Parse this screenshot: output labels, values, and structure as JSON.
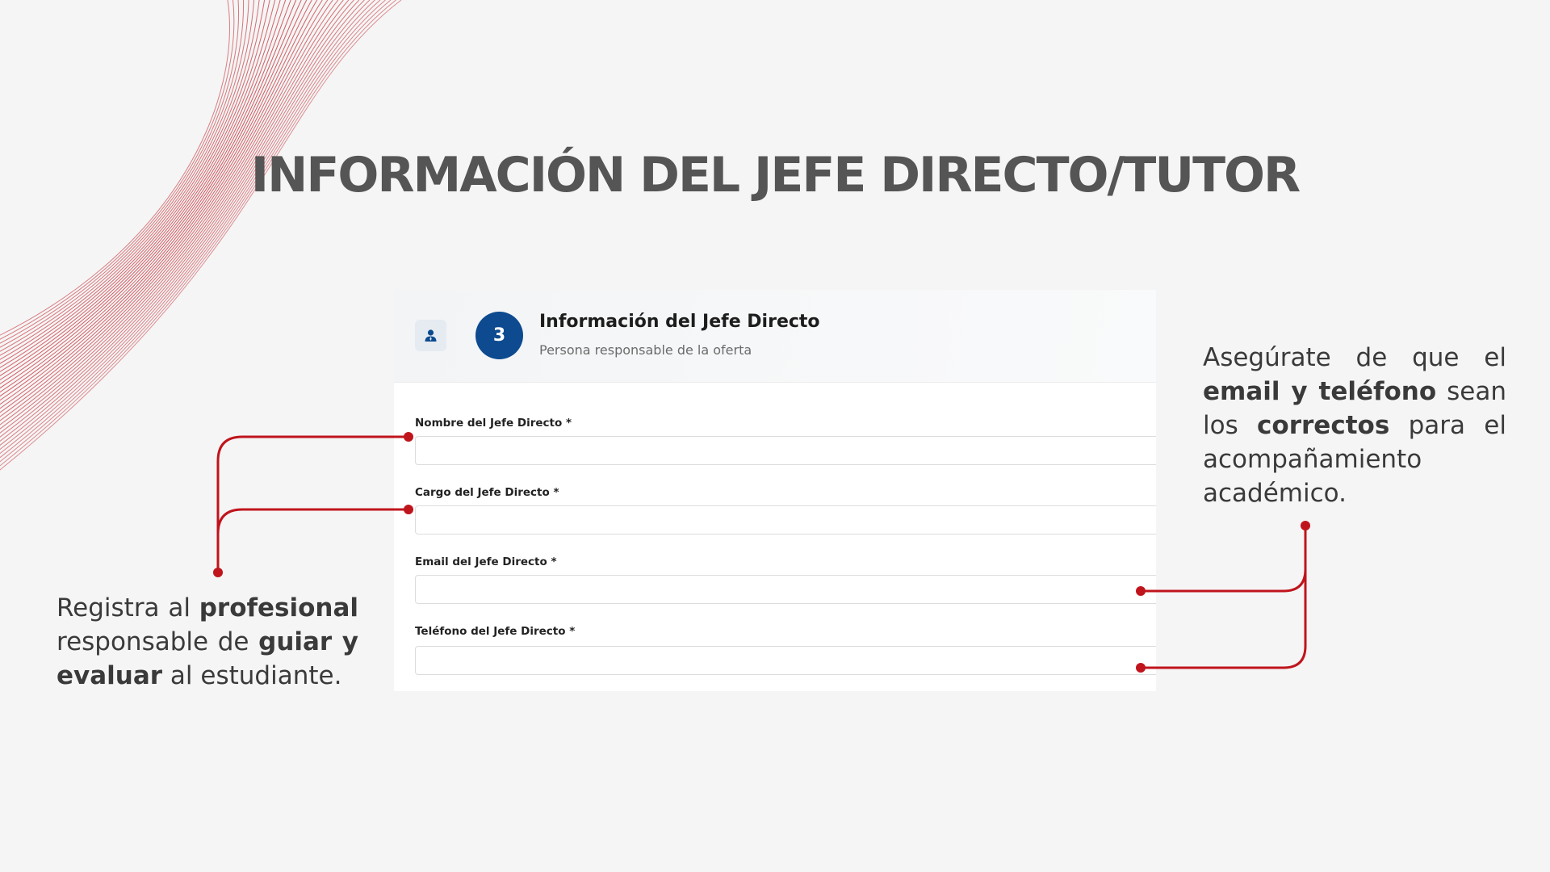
{
  "slide": {
    "title": "INFORMACIÓN DEL JEFE DIRECTO/TUTOR"
  },
  "card": {
    "icon": "user-icon",
    "step_number": "3",
    "title": "Información del Jefe Directo",
    "subtitle": "Persona responsable de la oferta",
    "fields": [
      {
        "label": "Nombre del Jefe Directo *",
        "value": ""
      },
      {
        "label": "Cargo del Jefe Directo *",
        "value": ""
      },
      {
        "label": "Email del Jefe Directo *",
        "value": ""
      },
      {
        "label": "Teléfono del Jefe Directo *",
        "value": ""
      }
    ],
    "step_color": "#0d4a8f"
  },
  "notes": {
    "left": {
      "t1": "Registra al ",
      "b1": "profesional",
      "t2": " responsable de ",
      "b2": "guiar y evaluar",
      "t3": " al estudiante."
    },
    "right": {
      "t1": "Asegúrate de que el ",
      "b1": "email y teléfono",
      "t2": " sean los ",
      "b2": "correctos",
      "t3": " para el acompañamiento académico."
    }
  },
  "colors": {
    "accent": "#c0141c",
    "title": "#555555",
    "background": "#f5f5f5"
  }
}
